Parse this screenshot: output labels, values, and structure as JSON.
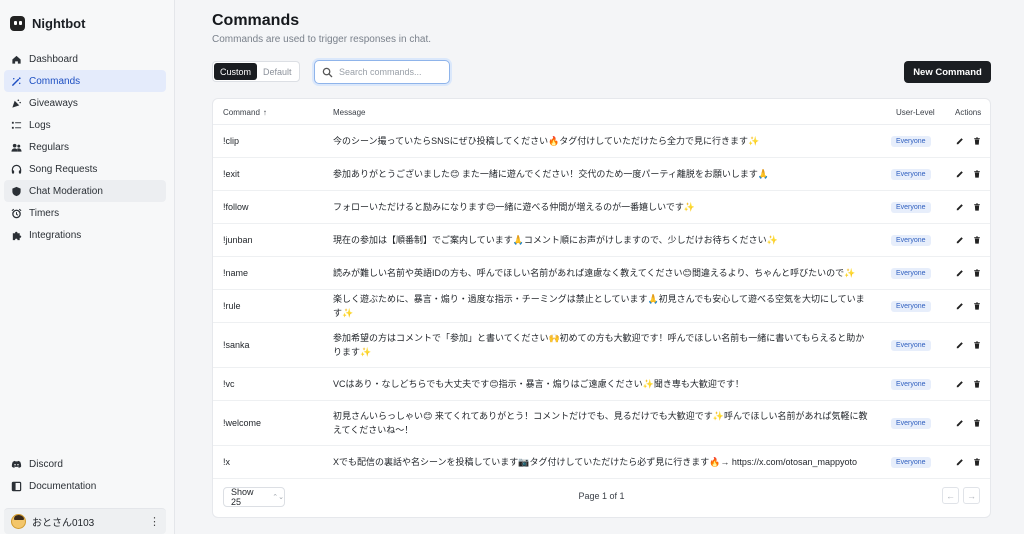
{
  "brand": {
    "name": "Nightbot"
  },
  "nav": [
    {
      "label": "Dashboard",
      "icon": "home-icon",
      "name": "sidebar-item-dashboard"
    },
    {
      "label": "Commands",
      "icon": "wand-icon",
      "name": "sidebar-item-commands",
      "active": true
    },
    {
      "label": "Giveaways",
      "icon": "party-icon",
      "name": "sidebar-item-giveaways"
    },
    {
      "label": "Logs",
      "icon": "list-icon",
      "name": "sidebar-item-logs"
    },
    {
      "label": "Regulars",
      "icon": "users-icon",
      "name": "sidebar-item-regulars"
    },
    {
      "label": "Song Requests",
      "icon": "headphones-icon",
      "name": "sidebar-item-song-requests"
    },
    {
      "label": "Chat Moderation",
      "icon": "shield-icon",
      "name": "sidebar-item-chat-moderation",
      "hover": true
    },
    {
      "label": "Timers",
      "icon": "alarm-icon",
      "name": "sidebar-item-timers"
    },
    {
      "label": "Integrations",
      "icon": "puzzle-icon",
      "name": "sidebar-item-integrations"
    }
  ],
  "nav_bottom": [
    {
      "label": "Discord",
      "icon": "discord-icon",
      "name": "sidebar-item-discord"
    },
    {
      "label": "Documentation",
      "icon": "book-icon",
      "name": "sidebar-item-documentation"
    }
  ],
  "user": {
    "name": "おとさん0103"
  },
  "page": {
    "title": "Commands",
    "subtitle": "Commands are used to trigger responses in chat."
  },
  "toggle": {
    "custom": "Custom",
    "default": "Default",
    "selected": "Custom"
  },
  "search": {
    "placeholder": "Search commands..."
  },
  "new_command_label": "New Command",
  "table": {
    "headers": {
      "command": "Command",
      "message": "Message",
      "user_level": "User-Level",
      "actions": "Actions"
    },
    "sort_indicator": "↑",
    "rows": [
      {
        "command": "!clip",
        "message": "今のシーン撮っていたらSNSにぜひ投稿してください🔥タグ付けしていただけたら全力で見に行きます✨",
        "level": "Everyone"
      },
      {
        "command": "!exit",
        "message": "参加ありがとうございました😊 また一緒に遊んでください！交代のため一度パーティ離脱をお願いします🙏",
        "level": "Everyone"
      },
      {
        "command": "!follow",
        "message": "フォローいただけると励みになります😊一緒に遊べる仲間が増えるのが一番嬉しいです✨",
        "level": "Everyone"
      },
      {
        "command": "!junban",
        "message": "現在の参加は【順番制】でご案内しています🙏コメント順にお声がけしますので、少しだけお待ちください✨",
        "level": "Everyone"
      },
      {
        "command": "!name",
        "message": "読みが難しい名前や英語IDの方も、呼んでほしい名前があれば遠慮なく教えてください😊間違えるより、ちゃんと呼びたいので✨",
        "level": "Everyone"
      },
      {
        "command": "!rule",
        "message": "楽しく遊ぶために、暴言・煽り・過度な指示・チーミングは禁止としています🙏初見さんでも安心して遊べる空気を大切にしています✨",
        "level": "Everyone"
      },
      {
        "command": "!sanka",
        "message": "参加希望の方はコメントで「参加」と書いてください🙌初めての方も大歓迎です！呼んでほしい名前も一緒に書いてもらえると助かります✨",
        "level": "Everyone"
      },
      {
        "command": "!vc",
        "message": "VCはあり・なしどちらでも大丈夫です😊指示・暴言・煽りはご遠慮ください✨聞き専も大歓迎です！",
        "level": "Everyone"
      },
      {
        "command": "!welcome",
        "message": "初見さんいらっしゃい😊 来てくれてありがとう！コメントだけでも、見るだけでも大歓迎です✨呼んでほしい名前があれば気軽に教えてくださいね〜！",
        "level": "Everyone"
      },
      {
        "command": "!x",
        "message": "Xでも配信の裏話や名シーンを投稿しています📷タグ付けしていただけたら必ず見に行きます🔥→ https://x.com/otosan_mappyoto",
        "level": "Everyone"
      }
    ]
  },
  "footer": {
    "show_label": "Show 25",
    "page_info": "Page 1 of 1",
    "prev": "←",
    "next": "→"
  }
}
